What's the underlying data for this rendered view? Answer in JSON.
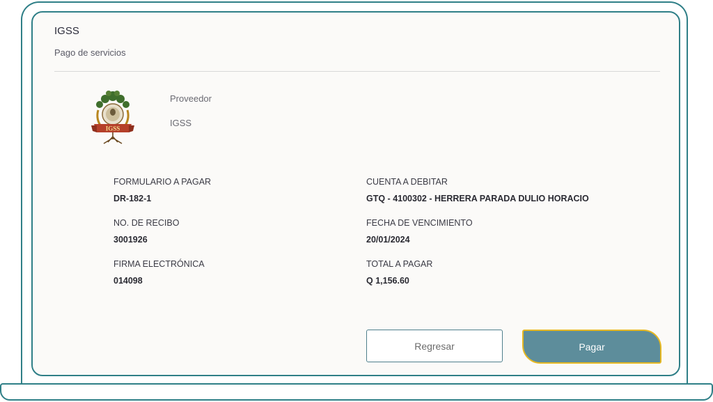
{
  "header": {
    "title": "IGSS",
    "subtitle": "Pago de servicios"
  },
  "provider": {
    "logo_text": "IGSS",
    "label": "Proveedor",
    "value": "IGSS"
  },
  "fields": {
    "formulario_label": "FORMULARIO A PAGAR",
    "formulario_value": "DR-182-1",
    "cuenta_label": "CUENTA A DEBITAR",
    "cuenta_value": "GTQ - 4100302 - HERRERA PARADA DULIO HORACIO",
    "recibo_label": "NO. DE RECIBO",
    "recibo_value": "3001926",
    "vencimiento_label": "FECHA DE VENCIMIENTO",
    "vencimiento_value": "20/01/2024",
    "firma_label": "FIRMA ELECTRÓNICA",
    "firma_value": "014098",
    "total_label": "TOTAL A PAGAR",
    "total_value": "Q 1,156.60"
  },
  "actions": {
    "back_label": "Regresar",
    "pay_label": "Pagar"
  },
  "colors": {
    "frame": "#2f7f87",
    "primary_button": "#5d8d9b",
    "primary_button_outline": "#e6b822"
  }
}
